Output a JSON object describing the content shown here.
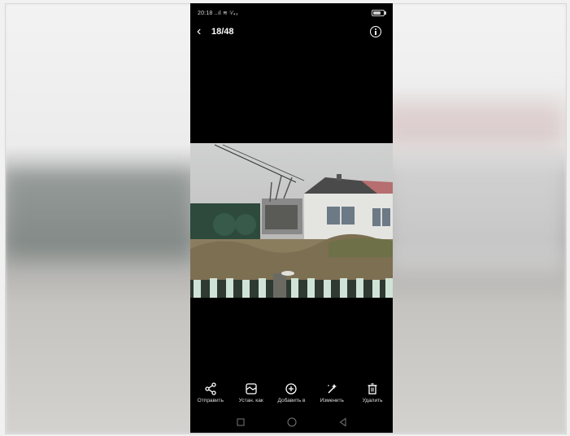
{
  "status_bar": {
    "time_signal": "20:18 ..ıl ≋ ⁵⁄₄₃"
  },
  "header": {
    "counter": "18/48"
  },
  "toolbar": {
    "items": [
      {
        "label": "Отправить",
        "icon": "share-icon"
      },
      {
        "label": "Устан. как",
        "icon": "set-as-icon"
      },
      {
        "label": "Добавить в",
        "icon": "add-circle-icon"
      },
      {
        "label": "Изменить",
        "icon": "edit-magic-wand-icon"
      },
      {
        "label": "Удалить",
        "icon": "trash-icon"
      }
    ]
  },
  "navbar": [
    "square-recents-icon",
    "circle-home-icon",
    "triangle-back-icon"
  ]
}
